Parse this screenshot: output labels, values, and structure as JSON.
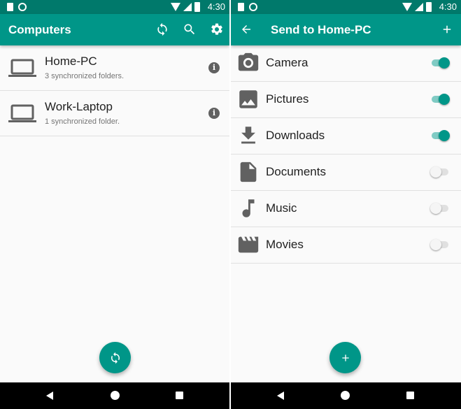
{
  "status_bar": {
    "time": "4:30"
  },
  "computers_screen": {
    "title": "Computers",
    "computers": [
      {
        "name": "Home-PC",
        "subtitle": "3 synchronized folders."
      },
      {
        "name": "Work-Laptop",
        "subtitle": "1 synchronized folder."
      }
    ]
  },
  "send_screen": {
    "title": "Send to Home-PC",
    "folders": [
      {
        "label": "Camera",
        "icon": "camera-icon",
        "enabled": true
      },
      {
        "label": "Pictures",
        "icon": "image-icon",
        "enabled": true
      },
      {
        "label": "Downloads",
        "icon": "download-icon",
        "enabled": true
      },
      {
        "label": "Documents",
        "icon": "document-icon",
        "enabled": false
      },
      {
        "label": "Music",
        "icon": "music-note-icon",
        "enabled": false
      },
      {
        "label": "Movies",
        "icon": "movie-clapper-icon",
        "enabled": false
      }
    ]
  },
  "colors": {
    "primary": "#009688",
    "primary_dark": "#00796b",
    "icon_gray": "#616161"
  }
}
